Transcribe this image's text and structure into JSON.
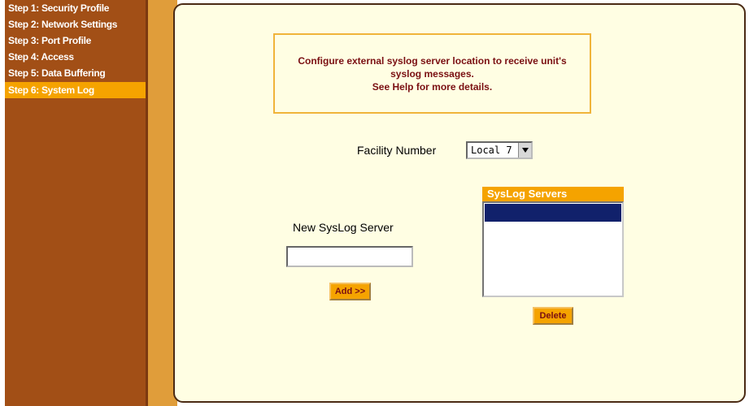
{
  "nav": {
    "items": [
      {
        "label": "Step 1: Security Profile"
      },
      {
        "label": "Step 2: Network Settings"
      },
      {
        "label": "Step 3: Port Profile"
      },
      {
        "label": "Step 4: Access"
      },
      {
        "label": "Step 5: Data Buffering"
      },
      {
        "label": "Step 6: System Log"
      }
    ],
    "active_index": 5
  },
  "info": {
    "line1": "Configure external syslog server location to receive unit's",
    "line2": "syslog messages.",
    "line3": "See Help for more details."
  },
  "facility": {
    "label": "Facility Number",
    "value": "Local 7"
  },
  "new_server": {
    "label": "New SysLog Server",
    "value": "",
    "add_label": "Add >>"
  },
  "servers": {
    "header": "SysLog Servers",
    "items": [],
    "delete_label": "Delete"
  },
  "colors": {
    "nav_bg": "#a24f16",
    "active_item": "#f5a300",
    "panel_bg": "#fffee3",
    "text_accent": "#7a0f12",
    "selection": "#11216b"
  }
}
